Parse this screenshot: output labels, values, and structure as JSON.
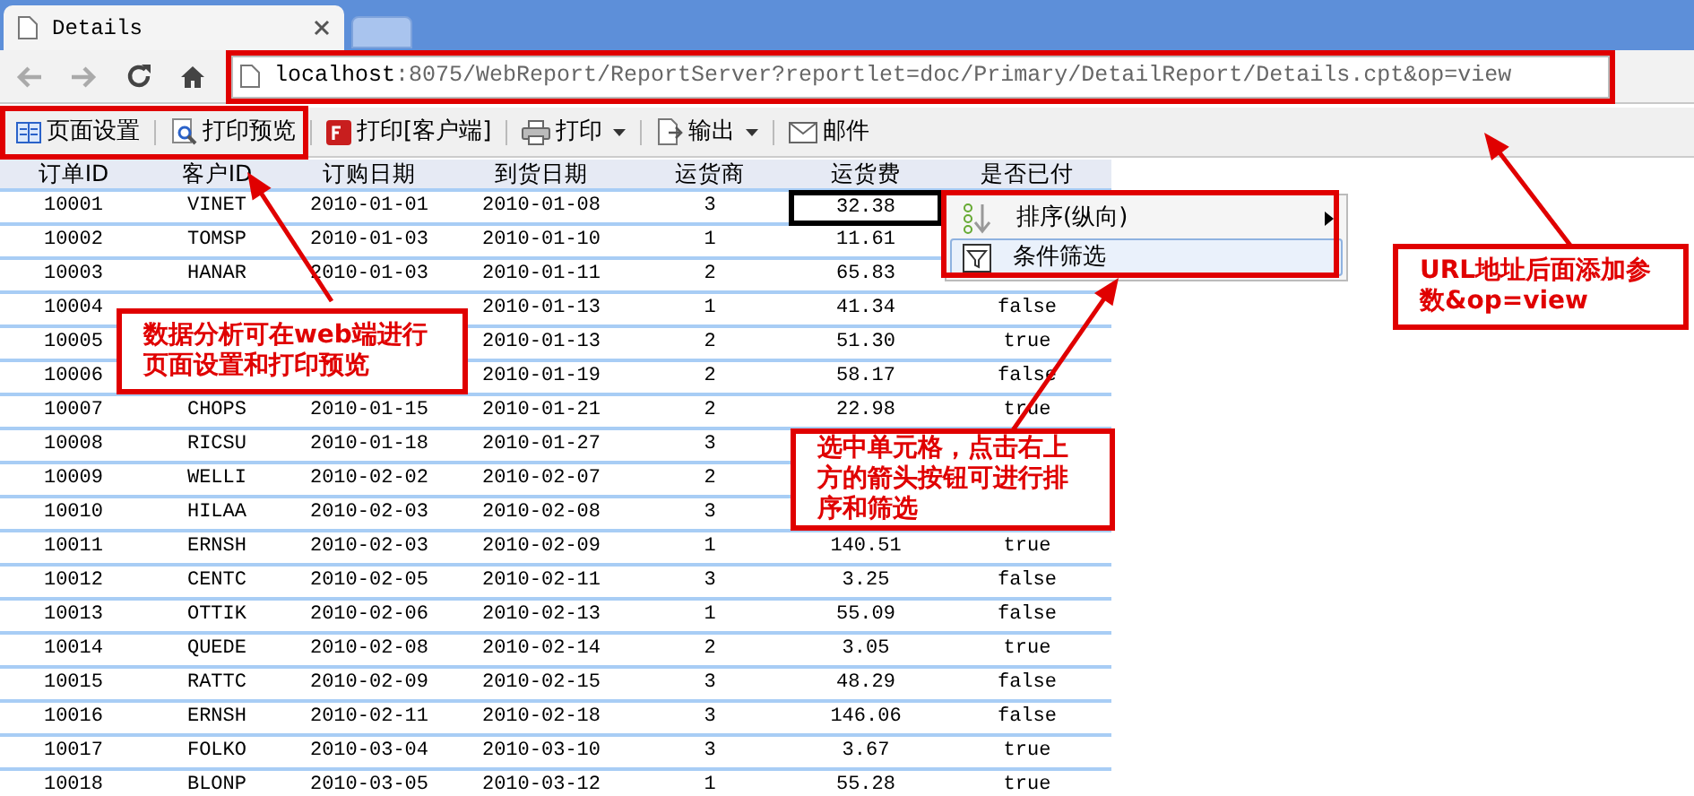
{
  "browser": {
    "tab_title": "Details",
    "url_host": "localhost",
    "url_rest": ":8075/WebReport/ReportServer?reportlet=doc/Primary/DetailReport/Details.cpt&op=view"
  },
  "toolbar": [
    {
      "kind": "page",
      "label": "页面设置",
      "dropdown": false
    },
    {
      "kind": "preview",
      "label": "打印预览",
      "dropdown": false
    },
    {
      "kind": "flash",
      "label": "打印[客户端]",
      "dropdown": false
    },
    {
      "kind": "printer",
      "label": "打印",
      "dropdown": true
    },
    {
      "kind": "export",
      "label": "输出",
      "dropdown": true
    },
    {
      "kind": "mail",
      "label": "邮件",
      "dropdown": false
    }
  ],
  "table": {
    "columns": [
      "订单ID",
      "客户ID",
      "订购日期",
      "到货日期",
      "运货商",
      "运货费",
      "是否已付"
    ],
    "rows": [
      {
        "cells": [
          "10001",
          "VINET",
          "2010-01-01",
          "2010-01-08",
          "3",
          {
            "text": "32.38",
            "selected": true
          },
          null
        ]
      },
      {
        "cells": [
          "10002",
          "TOMSP",
          "2010-01-03",
          "2010-01-10",
          "1",
          "11.61",
          null
        ]
      },
      {
        "cells": [
          "10003",
          "HANAR",
          "2010-01-03",
          "2010-01-11",
          "2",
          "65.83",
          null
        ]
      },
      {
        "cells": [
          "10004",
          null,
          null,
          "2010-01-13",
          "1",
          "41.34",
          "false"
        ]
      },
      {
        "cells": [
          "10005",
          null,
          null,
          "2010-01-13",
          "2",
          "51.30",
          "true"
        ]
      },
      {
        "cells": [
          "10006",
          null,
          null,
          "2010-01-19",
          "2",
          "58.17",
          "false"
        ]
      },
      {
        "cells": [
          "10007",
          "CHOPS",
          "2010-01-15",
          "2010-01-21",
          "2",
          "22.98",
          "true"
        ]
      },
      {
        "cells": [
          "10008",
          "RICSU",
          "2010-01-18",
          "2010-01-27",
          "3",
          null,
          null
        ]
      },
      {
        "cells": [
          "10009",
          "WELLI",
          "2010-02-02",
          "2010-02-07",
          "2",
          null,
          null
        ]
      },
      {
        "cells": [
          "10010",
          "HILAA",
          "2010-02-03",
          "2010-02-08",
          "3",
          null,
          null
        ]
      },
      {
        "cells": [
          "10011",
          "ERNSH",
          "2010-02-03",
          "2010-02-09",
          "1",
          "140.51",
          "true"
        ]
      },
      {
        "cells": [
          "10012",
          "CENTC",
          "2010-02-05",
          "2010-02-11",
          "3",
          "3.25",
          "false"
        ]
      },
      {
        "cells": [
          "10013",
          "OTTIK",
          "2010-02-06",
          "2010-02-13",
          "1",
          "55.09",
          "false"
        ]
      },
      {
        "cells": [
          "10014",
          "QUEDE",
          "2010-02-08",
          "2010-02-14",
          "2",
          "3.05",
          "true"
        ]
      },
      {
        "cells": [
          "10015",
          "RATTC",
          "2010-02-09",
          "2010-02-15",
          "3",
          "48.29",
          "false"
        ]
      },
      {
        "cells": [
          "10016",
          "ERNSH",
          "2010-02-11",
          "2010-02-18",
          "3",
          "146.06",
          "false"
        ]
      },
      {
        "cells": [
          "10017",
          "FOLKO",
          "2010-03-04",
          "2010-03-10",
          "3",
          "3.67",
          "true"
        ]
      },
      {
        "cells": [
          "10018",
          "BLONP",
          "2010-03-05",
          "2010-03-12",
          "1",
          "55.28",
          "true"
        ]
      }
    ]
  },
  "context_menu": [
    {
      "kind": "sort",
      "label": "排序(纵向)",
      "submenu": true,
      "selected": false
    },
    {
      "kind": "filter",
      "label": "条件筛选",
      "submenu": false,
      "selected": true
    }
  ],
  "callouts": [
    {
      "text": "数据分析可在web端进行页面设置和打印预览"
    },
    {
      "text": "选中单元格，点击右上方的箭头按钮可进行排序和筛选"
    },
    {
      "text": "URL地址后面添加参数&op=view"
    }
  ]
}
